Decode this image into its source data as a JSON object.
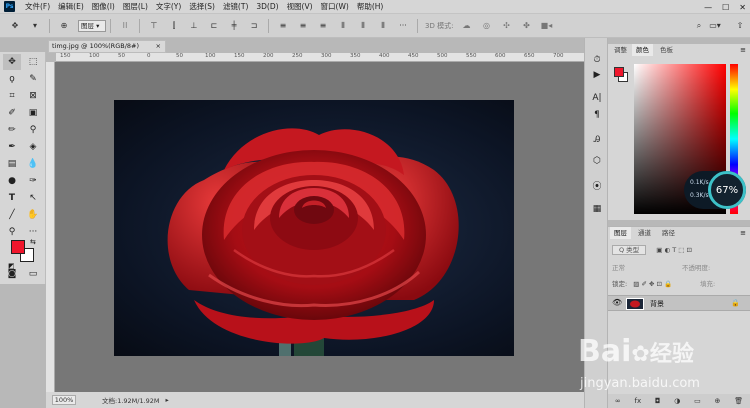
{
  "app": {
    "logo": "Ps"
  },
  "menu": [
    "文件(F)",
    "编辑(E)",
    "图像(I)",
    "图层(L)",
    "文字(Y)",
    "选择(S)",
    "滤镜(T)",
    "3D(D)",
    "视图(V)",
    "窗口(W)",
    "帮助(H)"
  ],
  "window_controls": [
    "—",
    "☐",
    "✕"
  ],
  "options_bar": {
    "layer_dropdown": "图层",
    "mode_3d_label": "3D 模式:"
  },
  "document": {
    "tab_title": "timg.jpg @ 100%(RGB/8#)",
    "tab_close": "×",
    "zoom": "100%",
    "doc_info": "文档:1.92M/1.92M"
  },
  "ruler_ticks": [
    "150",
    "100",
    "50",
    "0",
    "50",
    "100",
    "150",
    "200",
    "250",
    "300",
    "350",
    "400",
    "450",
    "500",
    "550",
    "600",
    "650",
    "700"
  ],
  "color_panel": {
    "tabs": [
      "调整",
      "颜色",
      "色板"
    ],
    "active_tab": 1,
    "fg": "#f0162c",
    "bg": "#ffffff"
  },
  "net_widget": {
    "percent": "67%",
    "up": "0.1K/s",
    "down": "0.3K/s"
  },
  "layers_panel": {
    "tabs": [
      "图层",
      "通道",
      "路径"
    ],
    "filter_label": "Q 类型",
    "blend_mode": "正常",
    "opacity_label": "不透明度:",
    "lock_label": "锁定:",
    "fill_label": "填充:",
    "layer_name": "背景",
    "footer_icons": [
      "∞",
      "fx",
      "◘",
      "◑",
      "▭",
      "⊕",
      "🗑"
    ]
  },
  "watermark": {
    "brand_text": "Bai",
    "brand_cn": "经验",
    "url": "jingyan.baidu.com"
  }
}
